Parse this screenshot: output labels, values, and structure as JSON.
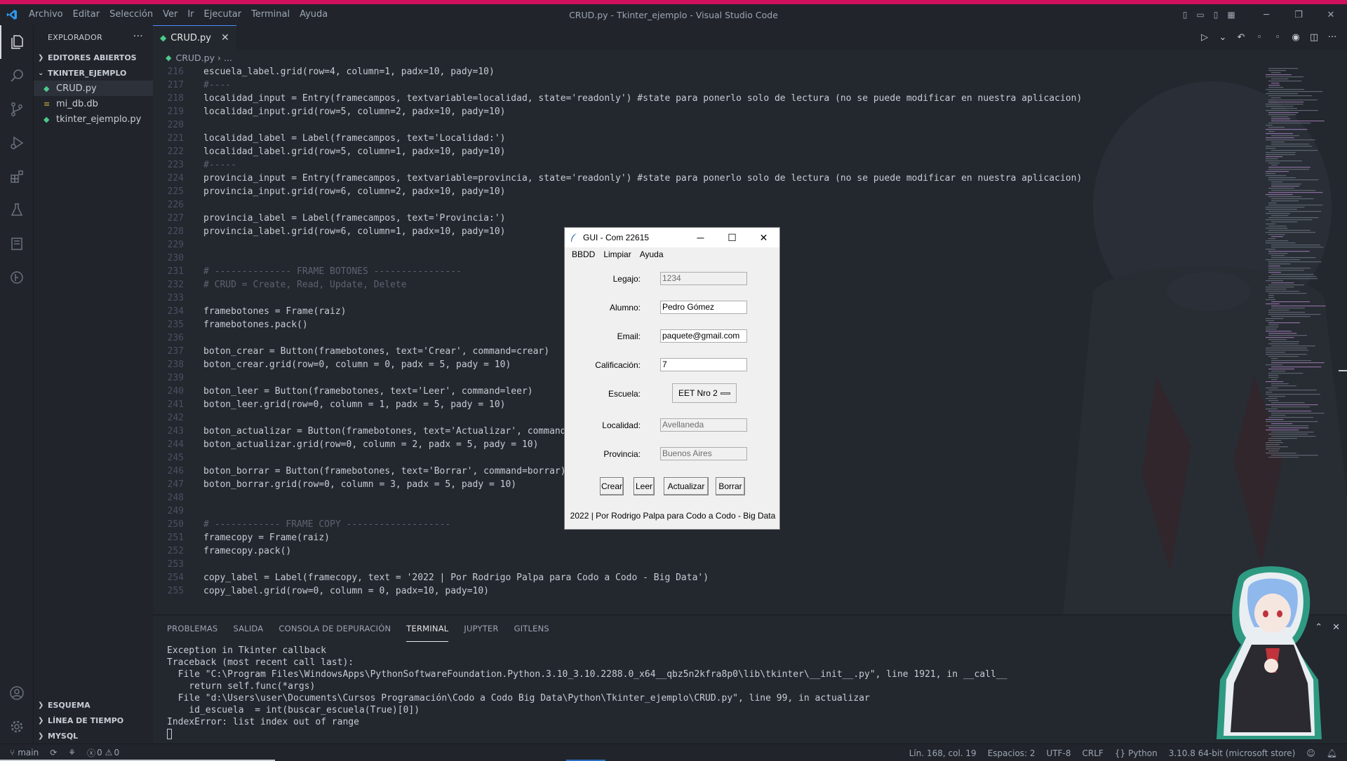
{
  "colors": {
    "accent_strip": "#d0105c",
    "activity_active": "#d7dae0",
    "icon_muted": "#6b717d",
    "tk_text": "#000000"
  },
  "titlebar": {
    "logo": "vscode-logo-icon",
    "menu": [
      "Archivo",
      "Editar",
      "Selección",
      "Ver",
      "Ir",
      "Ejecutar",
      "Terminal",
      "Ayuda"
    ],
    "title": "CRUD.py - Tkinter_ejemplo - Visual Studio Code",
    "window_controls": [
      "minimize-icon",
      "restore-icon",
      "close-icon"
    ]
  },
  "activitybar": {
    "top": [
      "explorer-icon",
      "search-icon",
      "source-control-icon",
      "run-debug-icon",
      "extensions-icon",
      "testing-icon",
      "remote-explorer-icon",
      "gitlens-icon"
    ],
    "bottom": [
      "accounts-icon",
      "settings-gear-icon"
    ]
  },
  "sidebar": {
    "title": "EXPLORADOR",
    "open_editors": "EDITORES ABIERTOS",
    "project": "TKINTER_EJEMPLO",
    "files": [
      {
        "name": "CRUD.py",
        "icon": "python-file-icon",
        "active": true
      },
      {
        "name": "mi_db.db",
        "icon": "database-file-icon",
        "active": false
      },
      {
        "name": "tkinter_ejemplo.py",
        "icon": "python-file-icon",
        "active": false
      }
    ],
    "bottom_sections": [
      "ESQUEMA",
      "LÍNEA DE TIEMPO",
      "MYSQL"
    ]
  },
  "editor": {
    "tab": "CRUD.py",
    "breadcrumb_file": "CRUD.py",
    "breadcrumb_more": "...",
    "lines": [
      {
        "n": "216",
        "t": "escuela_label.grid(row=4, column=1, padx=10, pady=10)"
      },
      {
        "n": "217",
        "t": "#----"
      },
      {
        "n": "218",
        "t": "localidad_input = Entry(framecampos, textvariable=localidad, state='readonly') #state para ponerlo solo de lectura (no se puede modificar en nuestra aplicacion)"
      },
      {
        "n": "219",
        "t": "localidad_input.grid(row=5, column=2, padx=10, pady=10)"
      },
      {
        "n": "220",
        "t": ""
      },
      {
        "n": "221",
        "t": "localidad_label = Label(framecampos, text='Localidad:')"
      },
      {
        "n": "222",
        "t": "localidad_label.grid(row=5, column=1, padx=10, pady=10)"
      },
      {
        "n": "223",
        "t": "#-----"
      },
      {
        "n": "224",
        "t": "provincia_input = Entry(framecampos, textvariable=provincia, state='readonly') #state para ponerlo solo de lectura (no se puede modificar en nuestra aplicacion)"
      },
      {
        "n": "225",
        "t": "provincia_input.grid(row=6, column=2, padx=10, pady=10)"
      },
      {
        "n": "226",
        "t": ""
      },
      {
        "n": "227",
        "t": "provincia_label = Label(framecampos, text='Provincia:')"
      },
      {
        "n": "228",
        "t": "provincia_label.grid(row=6, column=1, padx=10, pady=10)"
      },
      {
        "n": "229",
        "t": ""
      },
      {
        "n": "230",
        "t": ""
      },
      {
        "n": "231",
        "t": "# -------------- FRAME BOTONES ----------------"
      },
      {
        "n": "232",
        "t": "# CRUD = Create, Read, Update, Delete"
      },
      {
        "n": "233",
        "t": ""
      },
      {
        "n": "234",
        "t": "framebotones = Frame(raiz)"
      },
      {
        "n": "235",
        "t": "framebotones.pack()"
      },
      {
        "n": "236",
        "t": ""
      },
      {
        "n": "237",
        "t": "boton_crear = Button(framebotones, text='Crear', command=crear)"
      },
      {
        "n": "238",
        "t": "boton_crear.grid(row=0, column = 0, padx = 5, pady = 10)"
      },
      {
        "n": "239",
        "t": ""
      },
      {
        "n": "240",
        "t": "boton_leer = Button(framebotones, text='Leer', command=leer)"
      },
      {
        "n": "241",
        "t": "boton_leer.grid(row=0, column = 1, padx = 5, pady = 10)"
      },
      {
        "n": "242",
        "t": ""
      },
      {
        "n": "243",
        "t": "boton_actualizar = Button(framebotones, text='Actualizar', command=a"
      },
      {
        "n": "244",
        "t": "boton_actualizar.grid(row=0, column = 2, padx = 5, pady = 10)"
      },
      {
        "n": "245",
        "t": ""
      },
      {
        "n": "246",
        "t": "boton_borrar = Button(framebotones, text='Borrar', command=borrar)"
      },
      {
        "n": "247",
        "t": "boton_borrar.grid(row=0, column = 3, padx = 5, pady = 10)"
      },
      {
        "n": "248",
        "t": ""
      },
      {
        "n": "249",
        "t": ""
      },
      {
        "n": "250",
        "t": "# ------------ FRAME COPY -------------------"
      },
      {
        "n": "251",
        "t": "framecopy = Frame(raiz)"
      },
      {
        "n": "252",
        "t": "framecopy.pack()"
      },
      {
        "n": "253",
        "t": ""
      },
      {
        "n": "254",
        "t": "copy_label = Label(framecopy, text = '2022 | Por Rodrigo Palpa para Codo a Codo - Big Data')"
      },
      {
        "n": "255",
        "t": "copy_label.grid(row=0, column = 0, padx=10, pady=10)"
      }
    ]
  },
  "panel": {
    "tabs": [
      "PROBLEMAS",
      "SALIDA",
      "CONSOLA DE DEPURACIÓN",
      "TERMINAL",
      "JUPYTER",
      "GITLENS"
    ],
    "active_tab": "TERMINAL",
    "terminal": [
      "Exception in Tkinter callback",
      "Traceback (most recent call last):",
      "  File \"C:\\Program Files\\WindowsApps\\PythonSoftwareFoundation.Python.3.10_3.10.2288.0_x64__qbz5n2kfra8p0\\lib\\tkinter\\__init__.py\", line 1921, in __call__",
      "    return self.func(*args)",
      "  File \"d:\\Users\\user\\Documents\\Cursos Programación\\Codo a Codo Big Data\\Python\\Tkinter_ejemplo\\CRUD.py\", line 99, in actualizar",
      "    id_escuela  = int(buscar_escuela(True)[0])",
      "IndexError: list index out of range"
    ]
  },
  "statusbar": {
    "branch": "main",
    "errors": "0",
    "warnings": "0",
    "position": "Lín. 168, col. 19",
    "spaces": "Espacios: 2",
    "encoding": "UTF-8",
    "eol": "CRLF",
    "language": "Python",
    "interpreter": "3.10.8 64-bit (microsoft store)"
  },
  "tk": {
    "title": "GUI - Com 22615",
    "menu": [
      "BBDD",
      "Limpiar",
      "Ayuda"
    ],
    "fields": [
      {
        "label": "Legajo:",
        "value": "1234",
        "readonly": true
      },
      {
        "label": "Alumno:",
        "value": "Pedro Gómez",
        "readonly": false
      },
      {
        "label": "Email:",
        "value": "paquete@gmail.com",
        "readonly": false
      },
      {
        "label": "Calificación:",
        "value": "7",
        "readonly": false
      }
    ],
    "escuela_label": "Escuela:",
    "escuela_value": "EET Nro 2",
    "fields2": [
      {
        "label": "Localidad:",
        "value": "Avellaneda",
        "readonly": true
      },
      {
        "label": "Provincia:",
        "value": "Buenos Aires",
        "readonly": true
      }
    ],
    "buttons": [
      "Crear",
      "Leer",
      "Actualizar",
      "Borrar"
    ],
    "copy": "2022 | Por Rodrigo Palpa para Codo a Codo - Big Data"
  }
}
